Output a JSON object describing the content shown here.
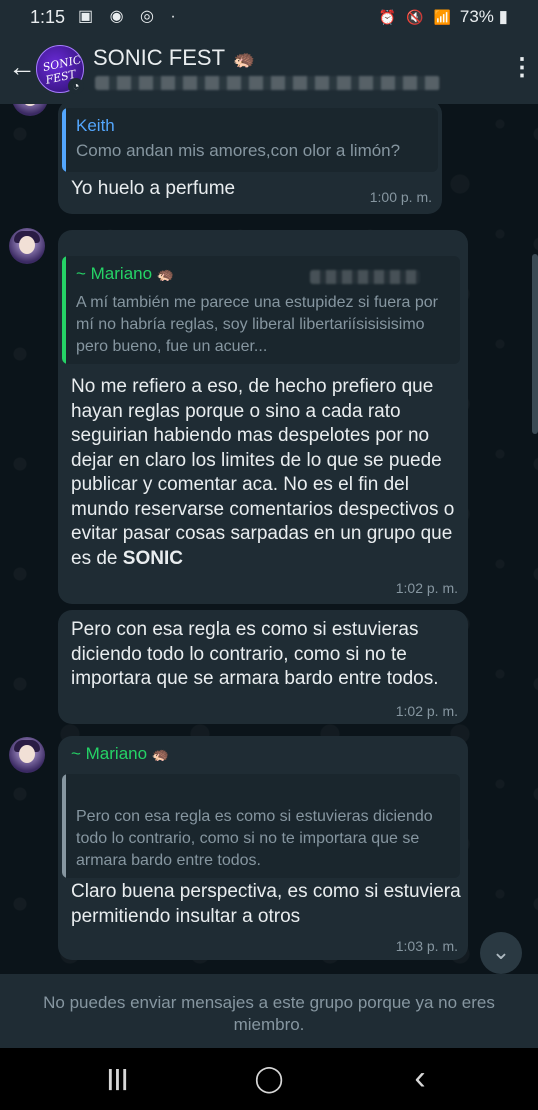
{
  "status_bar": {
    "time": "1:15",
    "left_icons": "▣ ◉ ◎ ·",
    "right_icons": "⏰ 🔇 📶",
    "battery": "73%"
  },
  "header": {
    "group_name": "SONIC FEST",
    "group_emoji": "🦔",
    "avatar_text": "SONIC FEST",
    "back_icon": "arrow-left-icon",
    "menu_icon": "kebab-icon"
  },
  "messages": [
    {
      "quote_name": "Keith",
      "quote_text": "Como andan mis amores,con olor a limón?",
      "text": "Yo huelo a perfume",
      "time": "1:00 p. m."
    },
    {
      "quote_name": "~ Mariano",
      "quote_text": "A mí también me parece una estupidez si fuera por mí no habría reglas, soy liberal libertariísisisisimo pero bueno, fue un acuer...",
      "text_pre": "No me refiero a eso, de hecho prefiero que hayan reglas porque o sino a cada rato seguirian habiendo mas despelotes por no dejar en claro los limites de lo que se puede publicar y comentar aca. No es el fin del mundo reservarse comentarios despectivos o evitar pasar cosas sarpadas en un grupo que es de ",
      "text_bold": "SONIC",
      "time": "1:02 p. m."
    },
    {
      "text": "Pero con esa regla es como si estuvieras diciendo todo lo contrario, como si no te importara que se armara bardo entre todos.",
      "time": "1:02 p. m."
    },
    {
      "sender": "~ Mariano",
      "quote_text": "Pero con esa regla es como si estuvieras diciendo todo lo contrario, como si no te importara que se armara bardo entre todos.",
      "text": "Claro buena perspectiva, es como si estuviera permitiendo insultar a otros",
      "time": "1:03 p. m."
    }
  ],
  "footer": {
    "notice": "No puedes enviar mensajes a este grupo porque ya no eres miembro."
  },
  "navbar": {
    "recent": "|||",
    "home": "◯",
    "back": "‹"
  },
  "colors": {
    "header_bg": "#1f2c34",
    "chat_bg": "#0b141a",
    "bubble_bg": "#1f2c34",
    "accent_green": "#25d366",
    "keith_blue": "#53a6fd"
  }
}
